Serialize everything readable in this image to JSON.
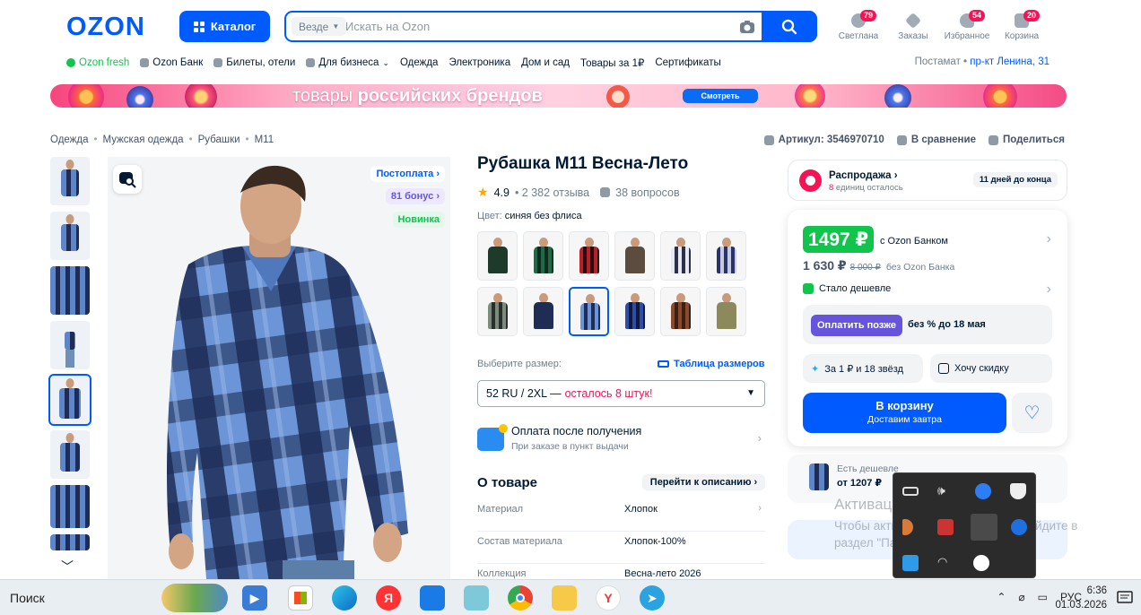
{
  "header": {
    "logo": "OZON",
    "catalog_label": "Каталог",
    "search_scope": "Везде",
    "search_placeholder": "Искать на Ozon",
    "icons": [
      {
        "name": "profile",
        "label": "Светлана",
        "badge": "79"
      },
      {
        "name": "orders",
        "label": "Заказы",
        "badge": ""
      },
      {
        "name": "favorites",
        "label": "Избранное",
        "badge": "54"
      },
      {
        "name": "cart",
        "label": "Корзина",
        "badge": "20"
      }
    ]
  },
  "nav": {
    "items": [
      "Ozon fresh",
      "Ozon Банк",
      "Билеты, отели",
      "Для бизнеса",
      "Одежда",
      "Электроника",
      "Дом и сад",
      "Товары за 1₽",
      "Сертификаты"
    ],
    "address_label": "Постамат •",
    "address_value": "пр-кт Ленина, 31"
  },
  "banner": {
    "text_light": "товары ",
    "text_bold": "российских брендов",
    "button": "Смотреть"
  },
  "breadcrumbs": [
    "Одежда",
    "Мужская одежда",
    "Рубашки",
    "M11"
  ],
  "meta": {
    "article": "Артикул: 3546970710",
    "compare": "В сравнение",
    "share": "Поделиться"
  },
  "image_tags": {
    "postpay": "Постоплата",
    "bonus": "81 бонус",
    "new": "Новинка"
  },
  "product": {
    "title": "Рубашка M11 Весна-Лето",
    "rating": "4.9",
    "reviews": "• 2 382 отзыва",
    "questions": "38 вопросов",
    "color_label": "Цвет: ",
    "color_value": "синяя без флиса",
    "size_label": "Выберите размер:",
    "size_table": "Таблица размеров",
    "size_selected": "52 RU / 2XL —",
    "size_left": "осталось 8 штук!",
    "payment_title": "Оплата после получения",
    "payment_sub": "При заказе в пункт выдачи",
    "about_title": "О товаре",
    "goto_description": "Перейти к описанию",
    "attributes": [
      {
        "k": "Материал",
        "v": "Хлопок"
      },
      {
        "k": "Состав материала",
        "v": "Хлопок-100%"
      },
      {
        "k": "Коллекция",
        "v": "Весна-лето 2026"
      }
    ]
  },
  "sale": {
    "title": "Распродажа",
    "count": "8",
    "sub": " единиц осталось",
    "days": "11 дней до конца"
  },
  "price": {
    "bank_price": "1497 ₽",
    "bank_label": "с Ozon Банком",
    "regular": "1 630 ₽",
    "old": "8 000 ₽",
    "regular_label": "без Ozon Банка",
    "cheaper": "Стало дешевле",
    "pay_later_btn": "Оплатить позже",
    "pay_later_txt": "без % до 18 мая",
    "chip_stars": "За 1 ₽ и 18 звёзд",
    "chip_discount": "Хочу скидку",
    "cart_title": "В корзину",
    "cart_sub": "Доставим завтра",
    "cheaper_title": "Есть дешевле",
    "cheaper_from": "от 1207 ₽"
  },
  "watermark": {
    "title": "Активация Windows",
    "text_a": "Чтобы активировать Windows, перейдите в",
    "text_b": "раздел \"Параметры\"."
  },
  "taskbar": {
    "search": "Поиск",
    "lang": "РУС",
    "time": "6:36",
    "date": "01.03.2026"
  }
}
